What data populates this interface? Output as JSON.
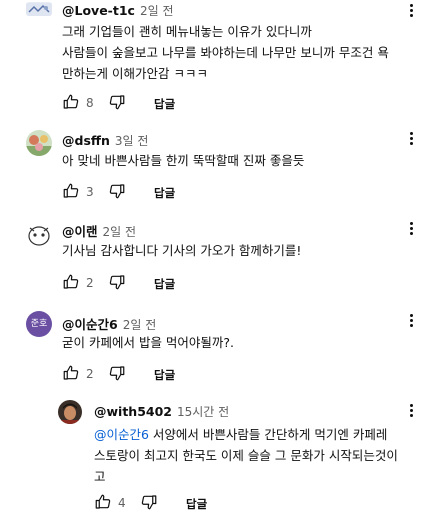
{
  "comments": [
    {
      "author": "@Love-t1c",
      "time": "2일 전",
      "text_lines": [
        "그래 기업들이 괜히 메뉴내놓는 이유가 있다니까",
        "사람들이 숲을보고 나무를 봐야하는데 나무만 보니까 무조건 욕",
        "만하는게 이해가안감 ㅋㅋㅋ"
      ],
      "likes": "8",
      "reply_label": "답글"
    },
    {
      "author": "@dsffn",
      "time": "3일 전",
      "text_lines": [
        "아 맞네 바쁜사람들 한끼 뚝딱할때 진짜 좋을듯"
      ],
      "likes": "3",
      "reply_label": "답글"
    },
    {
      "author": "@이랜",
      "time": "2일 전",
      "text_lines": [
        "기사님 감사합니다 기사의 가오가 함께하기를!"
      ],
      "likes": "2",
      "reply_label": "답글"
    },
    {
      "author": "@이순간6",
      "time": "2일 전",
      "avatar_text": "준호",
      "avatar_color": "#6a4fa3",
      "text_lines": [
        "굳이 카페에서 밥을 먹어야될까?."
      ],
      "likes": "2",
      "reply_label": "답글"
    }
  ],
  "reply": {
    "author": "@with5402",
    "time": "15시간 전",
    "mention": "@이순간6",
    "line1_rest": " 서양에서 바쁜사람들 간단하게 먹기엔 카페레",
    "text_lines": [
      "스토랑이 최고지  한국도 이제 슬슬 그 문화가 시작되는것이",
      "고"
    ],
    "likes": "4",
    "reply_label": "답글"
  },
  "colors": {
    "link": "#065fd4",
    "secondary_text": "#606060",
    "avatar_purple": "#6a4fa3"
  },
  "icons": [
    "thumb-up-icon",
    "thumb-down-icon",
    "more-vert-icon"
  ]
}
